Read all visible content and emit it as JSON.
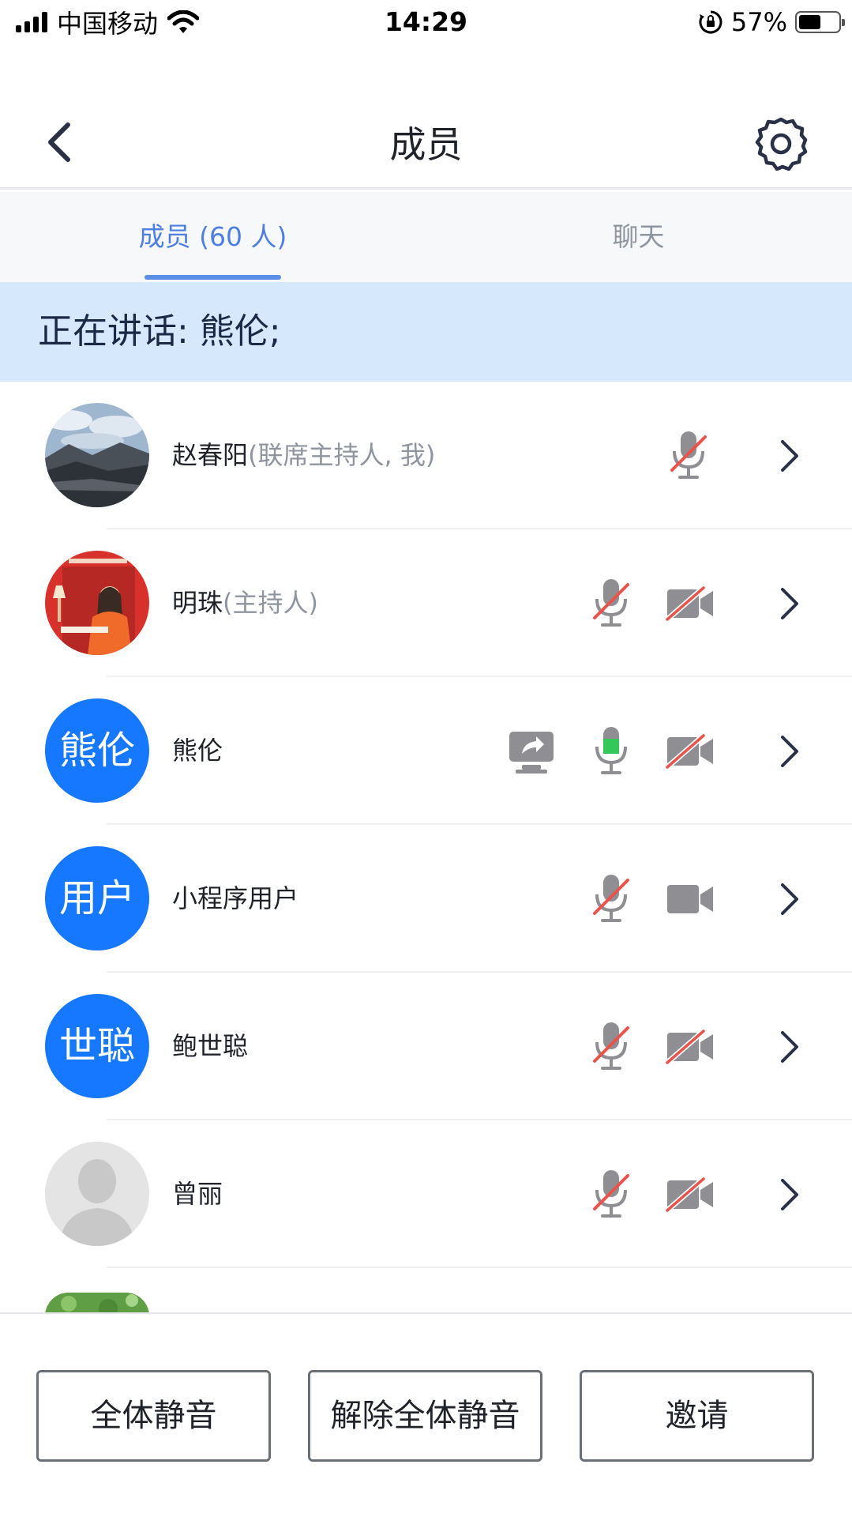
{
  "status_bar": {
    "carrier": "中国移动",
    "time": "14:29",
    "battery": "57%",
    "battery_level": 0.57
  },
  "header": {
    "title": "成员"
  },
  "tabs": [
    {
      "label": "成员 (60 人)",
      "active": true
    },
    {
      "label": "聊天",
      "active": false
    }
  ],
  "speaking_banner": "正在讲话: 熊伦;",
  "members": [
    {
      "name": "赵春阳",
      "role": "(联席主持人, 我)",
      "avatar": "landscape-photo",
      "avatar_text": "",
      "mic": "muted",
      "camera": "none",
      "sharing": false
    },
    {
      "name": "明珠",
      "role": "(主持人)",
      "avatar": "illustration-photo",
      "avatar_text": "",
      "mic": "muted",
      "camera": "off",
      "sharing": false
    },
    {
      "name": "熊伦",
      "role": "",
      "avatar": "text",
      "avatar_text": "熊伦",
      "mic": "speaking",
      "camera": "off",
      "sharing": true
    },
    {
      "name": "小程序用户",
      "role": "",
      "avatar": "text",
      "avatar_text": "用户",
      "mic": "muted",
      "camera": "on",
      "sharing": false
    },
    {
      "name": "鲍世聪",
      "role": "",
      "avatar": "text",
      "avatar_text": "世聪",
      "mic": "muted",
      "camera": "off",
      "sharing": false
    },
    {
      "name": "曾丽",
      "role": "",
      "avatar": "default-person",
      "avatar_text": "",
      "mic": "muted",
      "camera": "off",
      "sharing": false
    }
  ],
  "buttons": {
    "mute_all": "全体静音",
    "unmute_all": "解除全体静音",
    "invite": "邀请"
  },
  "colors": {
    "accent": "#4d7fe0",
    "avatar_blue": "#1677ff",
    "banner_bg": "#d6e8fc",
    "muted_slash": "#e8534a",
    "speaking_green": "#34c759",
    "icon_gray": "#8e8e93"
  }
}
